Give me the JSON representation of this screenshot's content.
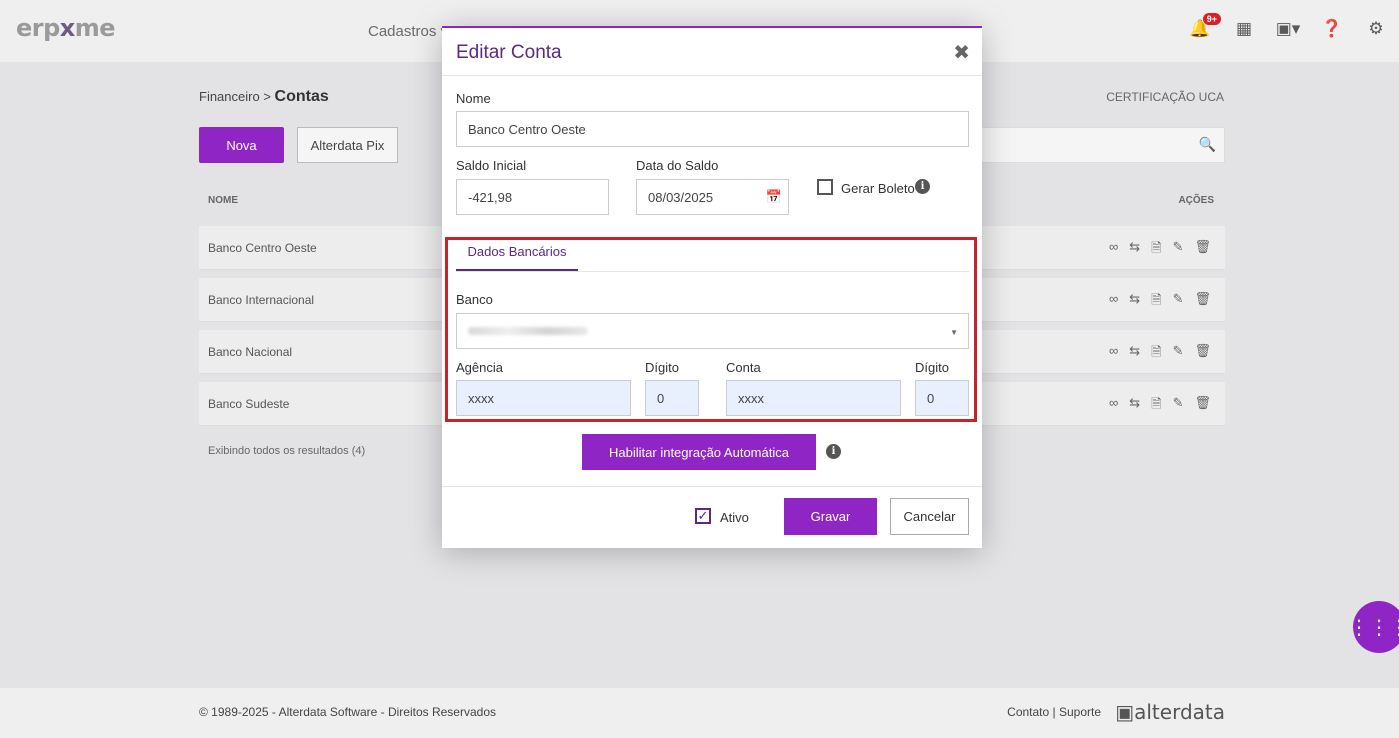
{
  "app": {
    "logo_prefix": "erp",
    "logo_mid": "x",
    "logo_suffix": "me"
  },
  "nav": {
    "cadastros": "Cadastros ▾"
  },
  "topbar": {
    "notification_badge": "9+"
  },
  "breadcrumb": {
    "parent": "Financeiro",
    "sep": ">",
    "current": "Contas"
  },
  "cert_label": "CERTIFICAÇÃO UCA",
  "toolbar": {
    "nova": "Nova",
    "pix": "Alterdata Pix"
  },
  "table": {
    "col_nome": "NOME",
    "col_acoes": "AÇÕES",
    "rows": [
      {
        "name": "Banco Centro Oeste"
      },
      {
        "name": "Banco Internacional"
      },
      {
        "name": "Banco Nacional"
      },
      {
        "name": "Banco Sudeste"
      }
    ],
    "results": "Exibindo todos os resultados (4)"
  },
  "footer": {
    "copyright": "© 1989-2025 - Alterdata Software - Direitos Reservados",
    "links": "Contato | Suporte",
    "brand": "alterdata"
  },
  "modal": {
    "title": "Editar Conta",
    "nome_label": "Nome",
    "nome_value": "Banco Centro Oeste",
    "saldo_label": "Saldo Inicial",
    "saldo_value": "-421,98",
    "data_label": "Data do Saldo",
    "data_value": "08/03/2025",
    "boleto_label": "Gerar Boleto",
    "tab_label": "Dados Bancários",
    "banco_label": "Banco",
    "agencia_label": "Agência",
    "agencia_value": "xxxx",
    "digito1_label": "Dígito",
    "digito1_value": "0",
    "conta_label": "Conta",
    "conta_value": "xxxx",
    "digito2_label": "Dígito",
    "digito2_value": "0",
    "integracao_label": "Habilitar integração Automática",
    "ativo_label": "Ativo",
    "gravar_label": "Gravar",
    "cancelar_label": "Cancelar"
  },
  "colors": {
    "accent": "#8e25c4",
    "title": "#5a2a82",
    "highlight": "#c8232b"
  }
}
